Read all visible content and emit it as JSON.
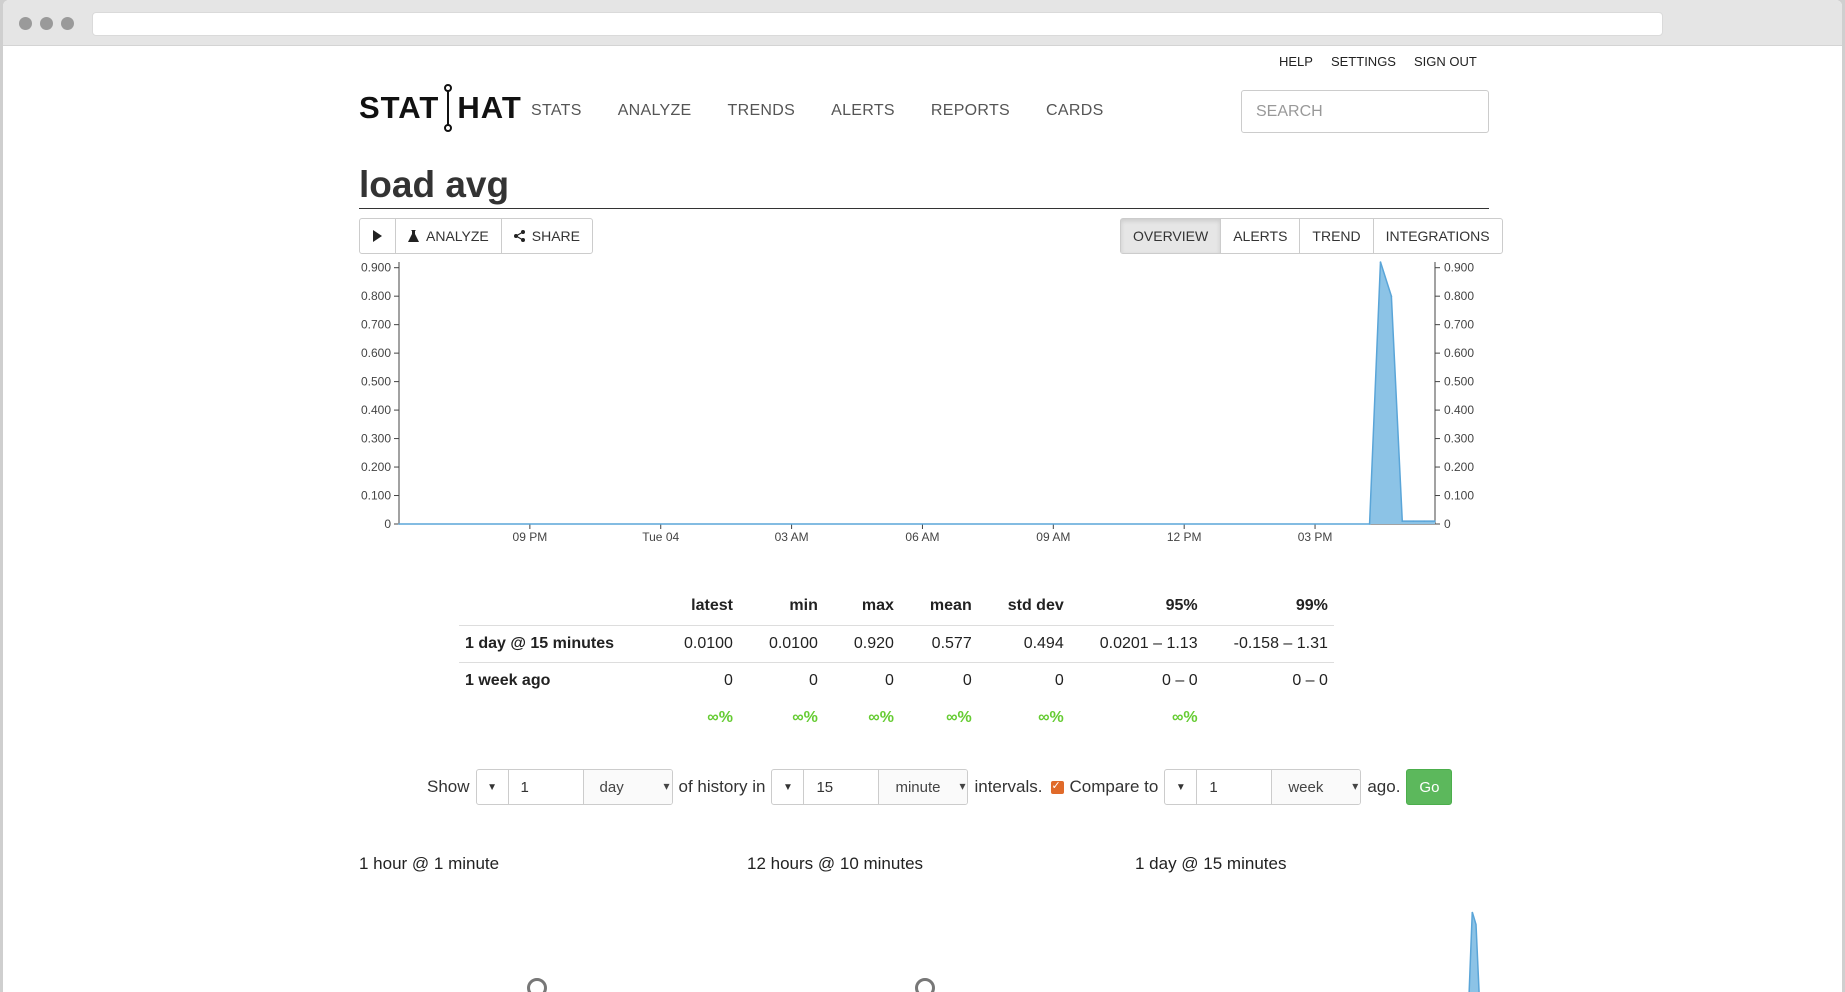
{
  "toplinks": [
    "HELP",
    "SETTINGS",
    "SIGN OUT"
  ],
  "logo": {
    "left": "STAT",
    "right": "HAT"
  },
  "nav": [
    "STATS",
    "ANALYZE",
    "TRENDS",
    "ALERTS",
    "REPORTS",
    "CARDS"
  ],
  "search": {
    "placeholder": "SEARCH"
  },
  "page_title": "load avg",
  "toolbar": {
    "play_icon": "play-icon",
    "analyze_label": "ANALYZE",
    "share_label": "SHARE"
  },
  "view_tabs": [
    {
      "label": "OVERVIEW",
      "active": true
    },
    {
      "label": "ALERTS",
      "active": false
    },
    {
      "label": "TREND",
      "active": false
    },
    {
      "label": "INTEGRATIONS",
      "active": false
    }
  ],
  "chart_data": {
    "type": "area",
    "title": "",
    "xlabel": "",
    "ylabel": "",
    "color": "#5aa5d8",
    "fill": "#8cc3e6",
    "ylim": [
      0,
      0.92
    ],
    "y_ticks": [
      "0",
      "0.100",
      "0.200",
      "0.300",
      "0.400",
      "0.500",
      "0.600",
      "0.700",
      "0.800",
      "0.900"
    ],
    "x_tick_labels": [
      "09 PM",
      "Tue 04",
      "03 AM",
      "06 AM",
      "09 AM",
      "12 PM",
      "03 PM"
    ],
    "x_tick_hours": [
      3,
      6,
      9,
      12,
      15,
      18,
      21
    ],
    "x_range_hours": [
      0,
      23.75
    ],
    "x_hours": [
      0,
      22.25,
      22.5,
      22.75,
      23.0,
      23.25,
      23.5,
      23.75
    ],
    "values": [
      0,
      0,
      0.92,
      0.8,
      0.01,
      0.01,
      0.01,
      0.01
    ]
  },
  "stats": {
    "headers": [
      "latest",
      "min",
      "max",
      "mean",
      "std dev",
      "95%",
      "99%"
    ],
    "rows": [
      {
        "label": "1 day @ 15 minutes",
        "values": [
          "0.0100",
          "0.0100",
          "0.920",
          "0.577",
          "0.494",
          "0.0201 – 1.13",
          "-0.158 – 1.31"
        ]
      },
      {
        "label": "1 week ago",
        "values": [
          "0",
          "0",
          "0",
          "0",
          "0",
          "0 – 0",
          "0 – 0"
        ]
      }
    ],
    "pct": [
      "∞%",
      "∞%",
      "∞%",
      "∞%",
      "∞%",
      "∞%"
    ]
  },
  "controls": {
    "show_label": "Show",
    "history_value": "1",
    "history_unit": "day",
    "of_history_label": "of history in",
    "interval_value": "15",
    "interval_unit": "minute",
    "intervals_label": "intervals.",
    "compare_label": "Compare to",
    "compare_checked": true,
    "compare_value": "1",
    "compare_unit": "week",
    "ago_label": "ago.",
    "go_label": "Go"
  },
  "mini_charts": [
    {
      "title": "1 hour @ 1 minute"
    },
    {
      "title": "12 hours @ 10 minutes"
    },
    {
      "title": "1 day @ 15 minutes"
    }
  ]
}
